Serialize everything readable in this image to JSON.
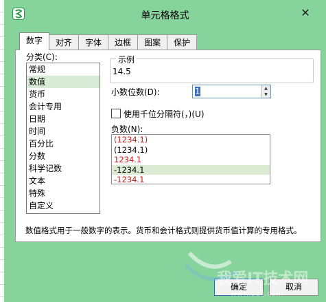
{
  "dialog": {
    "title": "单元格格式",
    "close_glyph": "✕"
  },
  "tabs": [
    {
      "label": "数字",
      "active": true
    },
    {
      "label": "对齐"
    },
    {
      "label": "字体"
    },
    {
      "label": "边框"
    },
    {
      "label": "图案"
    },
    {
      "label": "保护"
    }
  ],
  "category": {
    "label": "分类(C):",
    "items": [
      "常规",
      "数值",
      "货币",
      "会计专用",
      "日期",
      "时间",
      "百分比",
      "分数",
      "科学记数",
      "文本",
      "特殊",
      "自定义"
    ],
    "selected": "数值"
  },
  "sample": {
    "legend": "示例",
    "value": "14.5"
  },
  "decimal": {
    "label": "小数位数(D):",
    "value": "1"
  },
  "thousands": {
    "label": "使用千位分隔符(，)(U)",
    "checked": false
  },
  "negative": {
    "label": "负数(N):",
    "items": [
      {
        "text": "(1234.1)",
        "red": true
      },
      {
        "text": "(1234.1)",
        "red": false
      },
      {
        "text": "1234.1",
        "red": true
      },
      {
        "text": "-1234.1",
        "red": false,
        "selected": true
      },
      {
        "text": "-1234.1",
        "red": true
      }
    ]
  },
  "description": "数值格式用于一般数字的表示。货币和会计格式则提供货币值计算的专用格式。",
  "buttons": {
    "ok": "确定",
    "cancel": "取消"
  },
  "icons": {
    "app": "wps-app-icon",
    "close": "close-icon",
    "spin_up": "chevron-up-icon",
    "spin_down": "chevron-down-icon"
  },
  "colors": {
    "window_bg": "#86d39b",
    "negative_red": "#c0201e",
    "selection": "#d9ecd8"
  },
  "watermark": "我爱IT技术网 www.52ij.com"
}
